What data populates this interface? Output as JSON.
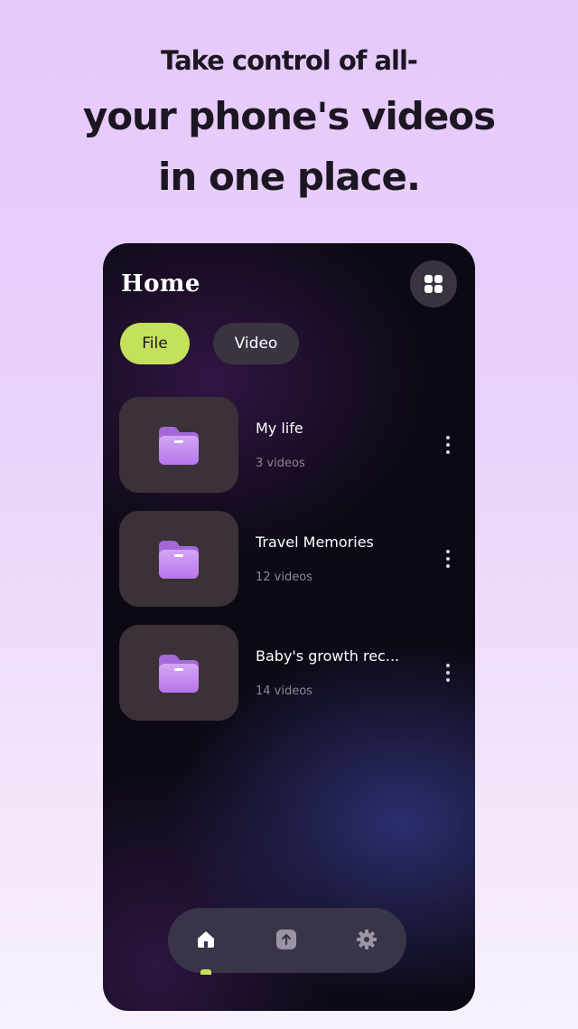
{
  "headline": {
    "line1": "Take control of all-",
    "line2": "your phone's videos",
    "line3": "in one place."
  },
  "app": {
    "title": "Home",
    "tabs": [
      {
        "label": "File",
        "active": true
      },
      {
        "label": "Video",
        "active": false
      }
    ],
    "folders": [
      {
        "name": "My life",
        "count": "3 videos"
      },
      {
        "name": "Travel Memories",
        "count": "12 videos"
      },
      {
        "name": "Baby's growth rec...",
        "count": "14 videos"
      }
    ],
    "nav": [
      {
        "icon": "home-icon",
        "active": true
      },
      {
        "icon": "upload-icon",
        "active": false
      },
      {
        "icon": "gear-icon",
        "active": false
      }
    ]
  },
  "colors": {
    "accent": "#c4e15c",
    "folder": "#c98cf0",
    "background_top": "#e6c9fb",
    "phone_bg": "#0c0914"
  }
}
